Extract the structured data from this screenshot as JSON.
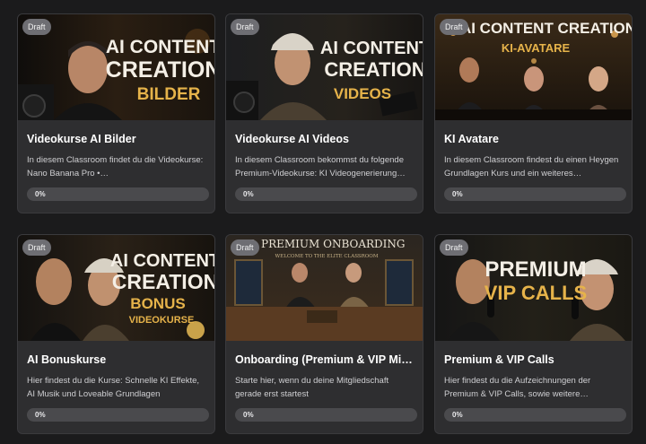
{
  "cards": [
    {
      "badge": "Draft",
      "image_text": {
        "line1": "AI CONTENT",
        "line2": "CREATION",
        "line3": "BILDER"
      },
      "title": "Videokurse AI Bilder",
      "description": "In diesem Classroom findet du die Videokurse: Nano Banana Pro •…",
      "progress_label": "0%",
      "progress": 0
    },
    {
      "badge": "Draft",
      "image_text": {
        "line1": "AI CONTENT",
        "line2": "CREATION",
        "line3": "VIDEOS"
      },
      "title": "Videokurse AI Videos",
      "description": "In diesem Classroom bekommst du folgende Premium-Videokurse: KI Videogenerierung…",
      "progress_label": "0%",
      "progress": 0
    },
    {
      "badge": "Draft",
      "image_text": {
        "line1": "AI CONTENT CREATION",
        "line2": "KI-AVATARE"
      },
      "title": "KI Avatare",
      "description": "In diesem Classroom findest du einen Heygen Grundlagen Kurs und ein weiteres…",
      "progress_label": "0%",
      "progress": 0
    },
    {
      "badge": "Draft",
      "image_text": {
        "line1": "AI CONTENT",
        "line2": "CREATION",
        "line3": "BONUS",
        "line4": "VIDEOKURSE"
      },
      "title": "AI Bonuskurse",
      "description": "Hier findest du die Kurse: Schnelle KI Effekte, AI Musik und Loveable Grundlagen",
      "progress_label": "0%",
      "progress": 0
    },
    {
      "badge": "Draft",
      "image_text": {
        "line1": "& PREMIUM ONBOARDING",
        "line2": "WELCOME TO THE ELITE CLASSROOM"
      },
      "title": "Onboarding (Premium & VIP Mitgl…",
      "description": "Starte hier, wenn du deine Mitgliedschaft gerade erst startest",
      "progress_label": "0%",
      "progress": 0
    },
    {
      "badge": "Draft",
      "image_text": {
        "line1": "PREMIUM",
        "line2": "VIP CALLS"
      },
      "title": "Premium & VIP Calls",
      "description": "Hier findest du die Aufzeichnungen der Premium & VIP Calls, sowie weitere…",
      "progress_label": "0%",
      "progress": 0
    }
  ]
}
